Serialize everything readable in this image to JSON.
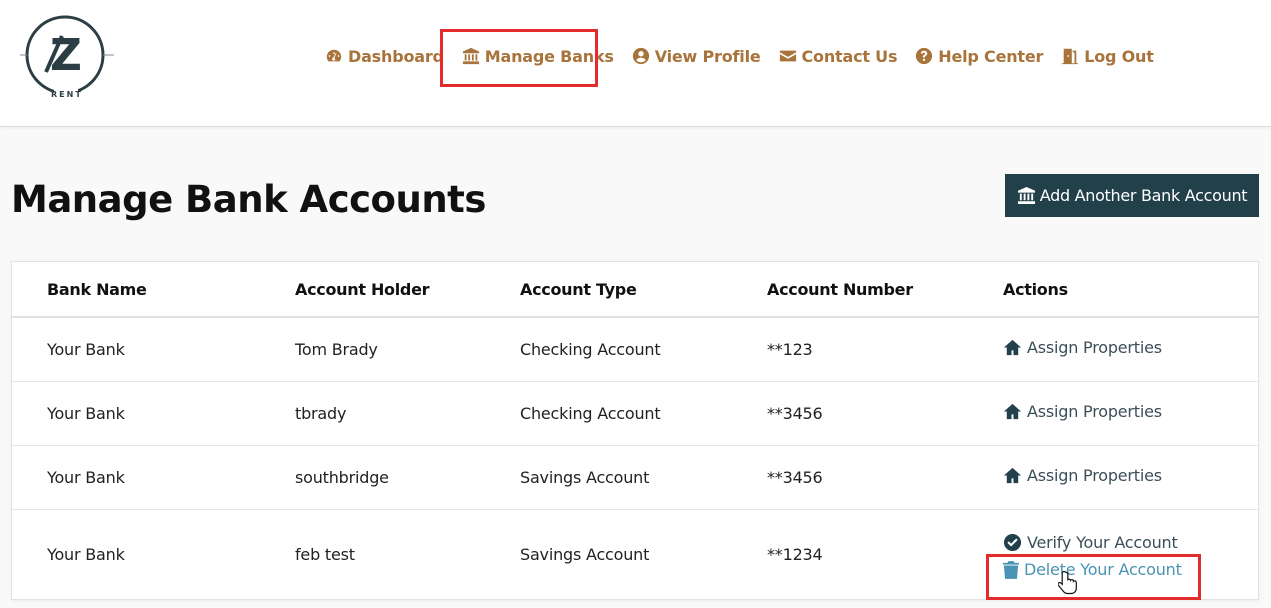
{
  "brand": {
    "logo_letter": "Z",
    "logo_word": "RENT"
  },
  "nav": {
    "items": [
      {
        "label": "Dashboard",
        "icon": "gauge-icon"
      },
      {
        "label": "Manage Banks",
        "icon": "bank-icon"
      },
      {
        "label": "View Profile",
        "icon": "user-circle-icon"
      },
      {
        "label": "Contact Us",
        "icon": "envelope-icon"
      },
      {
        "label": "Help Center",
        "icon": "question-circle-icon"
      },
      {
        "label": "Log Out",
        "icon": "door-exit-icon"
      }
    ]
  },
  "page": {
    "title": "Manage Bank Accounts",
    "add_button_label": "Add Another Bank Account"
  },
  "table": {
    "headers": [
      "Bank Name",
      "Account Holder",
      "Account Type",
      "Account Number",
      "Actions"
    ],
    "rows": [
      {
        "bank": "Your Bank",
        "holder": "Tom Brady",
        "type": "Checking Account",
        "number": "**123",
        "action": "Assign Properties"
      },
      {
        "bank": "Your Bank",
        "holder": "tbrady",
        "type": "Checking Account",
        "number": "**3456",
        "action": "Assign Properties"
      },
      {
        "bank": "Your Bank",
        "holder": "southbridge",
        "type": "Savings Account",
        "number": "**3456",
        "action": "Assign Properties"
      },
      {
        "bank": "Your Bank",
        "holder": "feb test",
        "type": "Savings Account",
        "number": "**1234",
        "verify": "Verify Your Account",
        "delete": "Delete Your Account"
      }
    ]
  },
  "colors": {
    "accent": "#a8743b",
    "dark": "#22404a",
    "link": "#4a93b3",
    "highlight": "#e32c2c"
  }
}
